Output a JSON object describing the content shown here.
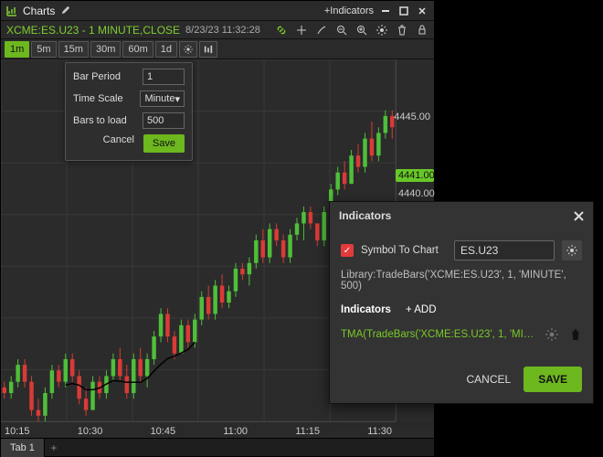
{
  "titlebar": {
    "title": "Charts",
    "add_indicators": "+Indicators"
  },
  "instrument": {
    "symbol_line": "XCME:ES.U23 - 1 MINUTE,CLOSE",
    "timestamp": "8/23/23 11:32:28"
  },
  "timeframes": {
    "items": [
      "1m",
      "5m",
      "15m",
      "30m",
      "60m",
      "1d"
    ],
    "active_index": 0
  },
  "settings_popover": {
    "bar_period_label": "Bar Period",
    "bar_period_value": "1",
    "time_scale_label": "Time Scale",
    "time_scale_value": "Minute",
    "bars_to_load_label": "Bars to load",
    "bars_to_load_value": "500",
    "cancel": "Cancel",
    "save": "Save"
  },
  "yaxis": {
    "ticks": [
      "4445.00"
    ],
    "last_price": "4441.00",
    "aux_price": "4440.00"
  },
  "xaxis": {
    "ticks": [
      "10:15",
      "10:30",
      "10:45",
      "11:00",
      "11:15",
      "11:30"
    ]
  },
  "tabs": {
    "tab1": "Tab 1"
  },
  "indicators_dialog": {
    "title": "Indicators",
    "symbol_to_chart_label": "Symbol To Chart",
    "symbol_value": "ES.U23",
    "library_line": "Library:TradeBars('XCME:ES.U23', 1, 'MINUTE', 500)",
    "indicators_label": "Indicators",
    "add_label": "+ ADD",
    "indicator0": "TMA(TradeBars('XCME:ES.U23', 1, 'MINUTE', 50...",
    "cancel": "CANCEL",
    "save": "SAVE"
  },
  "chart_data": {
    "type": "candlestick",
    "xlabel": "",
    "ylabel": "",
    "ylim": [
      4415,
      4447
    ],
    "x_ticks": [
      "10:15",
      "10:30",
      "10:45",
      "11:00",
      "11:15",
      "11:30"
    ],
    "last": 4441.0,
    "series": [
      {
        "o": 4418.0,
        "h": 4418.5,
        "l": 4417.0,
        "c": 4417.5
      },
      {
        "o": 4417.5,
        "h": 4419.0,
        "l": 4417.0,
        "c": 4418.5
      },
      {
        "o": 4418.5,
        "h": 4420.5,
        "l": 4418.0,
        "c": 4420.0
      },
      {
        "o": 4420.0,
        "h": 4420.5,
        "l": 4418.0,
        "c": 4418.5
      },
      {
        "o": 4418.5,
        "h": 4419.0,
        "l": 4415.5,
        "c": 4416.0
      },
      {
        "o": 4416.0,
        "h": 4417.0,
        "l": 4415.0,
        "c": 4415.5
      },
      {
        "o": 4415.5,
        "h": 4418.0,
        "l": 4415.0,
        "c": 4417.5
      },
      {
        "o": 4417.5,
        "h": 4420.0,
        "l": 4417.0,
        "c": 4419.5
      },
      {
        "o": 4419.5,
        "h": 4420.0,
        "l": 4418.0,
        "c": 4418.5
      },
      {
        "o": 4418.5,
        "h": 4421.0,
        "l": 4418.0,
        "c": 4420.5
      },
      {
        "o": 4420.5,
        "h": 4421.0,
        "l": 4418.5,
        "c": 4419.0
      },
      {
        "o": 4419.0,
        "h": 4419.5,
        "l": 4416.5,
        "c": 4417.0
      },
      {
        "o": 4417.0,
        "h": 4418.0,
        "l": 4415.5,
        "c": 4416.0
      },
      {
        "o": 4416.0,
        "h": 4419.0,
        "l": 4416.0,
        "c": 4418.5
      },
      {
        "o": 4418.5,
        "h": 4419.0,
        "l": 4417.0,
        "c": 4417.5
      },
      {
        "o": 4417.5,
        "h": 4419.5,
        "l": 4417.0,
        "c": 4419.0
      },
      {
        "o": 4419.0,
        "h": 4421.0,
        "l": 4418.5,
        "c": 4420.5
      },
      {
        "o": 4420.5,
        "h": 4421.5,
        "l": 4418.5,
        "c": 4419.0
      },
      {
        "o": 4419.0,
        "h": 4420.0,
        "l": 4417.0,
        "c": 4417.5
      },
      {
        "o": 4417.5,
        "h": 4421.0,
        "l": 4417.0,
        "c": 4420.5
      },
      {
        "o": 4420.5,
        "h": 4421.5,
        "l": 4418.5,
        "c": 4419.0
      },
      {
        "o": 4419.0,
        "h": 4421.0,
        "l": 4418.0,
        "c": 4420.5
      },
      {
        "o": 4420.5,
        "h": 4423.0,
        "l": 4420.0,
        "c": 4422.5
      },
      {
        "o": 4422.5,
        "h": 4425.0,
        "l": 4422.0,
        "c": 4424.5
      },
      {
        "o": 4424.5,
        "h": 4425.0,
        "l": 4422.0,
        "c": 4422.5
      },
      {
        "o": 4422.5,
        "h": 4423.0,
        "l": 4420.5,
        "c": 4421.0
      },
      {
        "o": 4421.0,
        "h": 4424.0,
        "l": 4421.0,
        "c": 4423.5
      },
      {
        "o": 4423.5,
        "h": 4424.0,
        "l": 4421.5,
        "c": 4422.0
      },
      {
        "o": 4422.0,
        "h": 4424.5,
        "l": 4421.5,
        "c": 4424.0
      },
      {
        "o": 4424.0,
        "h": 4426.5,
        "l": 4423.5,
        "c": 4426.0
      },
      {
        "o": 4426.0,
        "h": 4427.0,
        "l": 4424.0,
        "c": 4424.5
      },
      {
        "o": 4424.5,
        "h": 4427.5,
        "l": 4424.0,
        "c": 4427.0
      },
      {
        "o": 4427.0,
        "h": 4428.0,
        "l": 4425.0,
        "c": 4425.5
      },
      {
        "o": 4425.5,
        "h": 4427.0,
        "l": 4425.0,
        "c": 4426.5
      },
      {
        "o": 4426.5,
        "h": 4429.0,
        "l": 4426.0,
        "c": 4428.5
      },
      {
        "o": 4428.5,
        "h": 4429.0,
        "l": 4427.5,
        "c": 4428.0
      },
      {
        "o": 4428.0,
        "h": 4429.5,
        "l": 4427.0,
        "c": 4429.0
      },
      {
        "o": 4429.0,
        "h": 4431.5,
        "l": 4428.5,
        "c": 4431.0
      },
      {
        "o": 4431.0,
        "h": 4432.0,
        "l": 4429.0,
        "c": 4429.5
      },
      {
        "o": 4429.5,
        "h": 4432.5,
        "l": 4429.0,
        "c": 4432.0
      },
      {
        "o": 4432.0,
        "h": 4432.5,
        "l": 4430.5,
        "c": 4431.0
      },
      {
        "o": 4431.0,
        "h": 4431.5,
        "l": 4429.0,
        "c": 4429.5
      },
      {
        "o": 4429.5,
        "h": 4432.0,
        "l": 4429.0,
        "c": 4431.5
      },
      {
        "o": 4431.5,
        "h": 4433.0,
        "l": 4431.0,
        "c": 4432.5
      },
      {
        "o": 4432.5,
        "h": 4434.0,
        "l": 4431.0,
        "c": 4433.5
      },
      {
        "o": 4433.5,
        "h": 4434.0,
        "l": 4432.0,
        "c": 4432.5
      },
      {
        "o": 4432.5,
        "h": 4432.5,
        "l": 4430.5,
        "c": 4431.0
      },
      {
        "o": 4431.0,
        "h": 4434.0,
        "l": 4430.5,
        "c": 4433.5
      },
      {
        "o": 4433.5,
        "h": 4436.0,
        "l": 4433.0,
        "c": 4435.5
      },
      {
        "o": 4435.5,
        "h": 4437.5,
        "l": 4435.0,
        "c": 4437.0
      },
      {
        "o": 4437.0,
        "h": 4438.0,
        "l": 4435.5,
        "c": 4436.0
      },
      {
        "o": 4436.0,
        "h": 4439.0,
        "l": 4436.0,
        "c": 4438.5
      },
      {
        "o": 4438.5,
        "h": 4439.5,
        "l": 4437.0,
        "c": 4437.5
      },
      {
        "o": 4437.5,
        "h": 4440.5,
        "l": 4437.0,
        "c": 4440.0
      },
      {
        "o": 4440.0,
        "h": 4441.5,
        "l": 4438.0,
        "c": 4438.5
      },
      {
        "o": 4438.5,
        "h": 4441.0,
        "l": 4438.0,
        "c": 4440.5
      },
      {
        "o": 4440.5,
        "h": 4442.5,
        "l": 4440.0,
        "c": 4442.0
      },
      {
        "o": 4442.0,
        "h": 4442.5,
        "l": 4440.0,
        "c": 4441.0
      }
    ]
  }
}
